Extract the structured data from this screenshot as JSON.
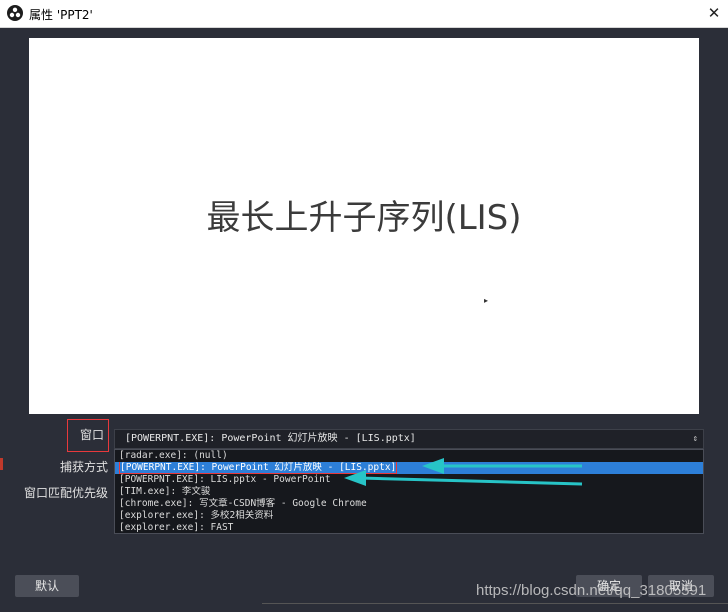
{
  "window": {
    "title": "属性 'PPT2'",
    "close_glyph": "✕"
  },
  "preview": {
    "slide_title": "最长上升子序列(LIS)"
  },
  "properties": {
    "window_label": "窗口",
    "capture_method_label": "捕获方式",
    "window_match_priority_label": "窗口匹配优先级",
    "window_select_value": "[POWERPNT.EXE]: PowerPoint 幻灯片放映 - [LIS.pptx]",
    "window_options": [
      "[radar.exe]: (null)",
      "[POWERPNT.EXE]: PowerPoint 幻灯片放映 - [LIS.pptx]",
      "[POWERPNT.EXE]: LIS.pptx - PowerPoint",
      "[TIM.exe]: 李文骏",
      "[chrome.exe]: 写文章-CSDN博客 - Google Chrome",
      "[explorer.exe]: 多校2相关资料",
      "[explorer.exe]: FAST"
    ],
    "selected_option_index": 1
  },
  "buttons": {
    "default": "默认",
    "ok": "确定",
    "cancel": "取消"
  },
  "watermark": "https://blog.csdn.net/qq_31805591",
  "colors": {
    "selected_highlight": "#2d7fd8",
    "annotation_arrow": "#27c4c7",
    "annotation_box": "#e8393c"
  }
}
